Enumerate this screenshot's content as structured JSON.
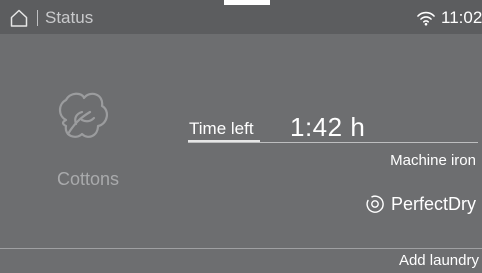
{
  "header": {
    "title": "Status",
    "time": "11:02",
    "home_icon": "home-icon",
    "wifi_icon": "wifi-icon"
  },
  "program": {
    "name": "Cottons",
    "icon": "cotton-icon"
  },
  "timer": {
    "label": "Time left",
    "value": "1:42 h"
  },
  "options": {
    "iron": "Machine iron",
    "perfectdry": "PerfectDry"
  },
  "footer": {
    "add_laundry": "Add laundry"
  },
  "colors": {
    "background": "#6d6e70",
    "topbar": "#5c5d5f",
    "text": "#ffffff",
    "muted_text": "#a9aaac"
  }
}
